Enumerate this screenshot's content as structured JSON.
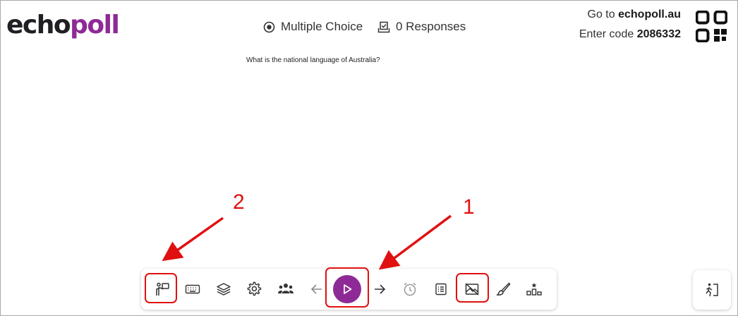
{
  "logo": {
    "part1": "echo",
    "part2": "poll"
  },
  "header": {
    "question_type": "Multiple Choice",
    "responses": "0 Responses",
    "join_prefix": "Go to",
    "join_url": "echopoll.au",
    "code_prefix": "Enter code",
    "code": "2086332"
  },
  "question": "What is the national language of Australia?",
  "toolbar": {
    "items": [
      {
        "name": "presenter-view",
        "icon": "presenter-icon"
      },
      {
        "name": "keyboard",
        "icon": "keyboard-icon"
      },
      {
        "name": "layers",
        "icon": "layers-icon"
      },
      {
        "name": "settings",
        "icon": "gear-icon"
      },
      {
        "name": "participants",
        "icon": "people-icon"
      },
      {
        "name": "previous",
        "icon": "arrow-left-icon"
      },
      {
        "name": "play",
        "icon": "play-icon"
      },
      {
        "name": "next",
        "icon": "arrow-right-icon"
      },
      {
        "name": "timer",
        "icon": "alarm-clock-icon"
      },
      {
        "name": "results-list",
        "icon": "list-icon"
      },
      {
        "name": "hide-image",
        "icon": "image-off-icon"
      },
      {
        "name": "brush",
        "icon": "brush-icon"
      },
      {
        "name": "leaderboard",
        "icon": "podium-icon"
      }
    ],
    "exit_icon": "exit-icon"
  },
  "annotations": {
    "label1": "1",
    "label2": "2",
    "color": "#e01010"
  },
  "colors": {
    "brand_purple": "#8e2a96",
    "logo_dark": "#1f1f24"
  }
}
